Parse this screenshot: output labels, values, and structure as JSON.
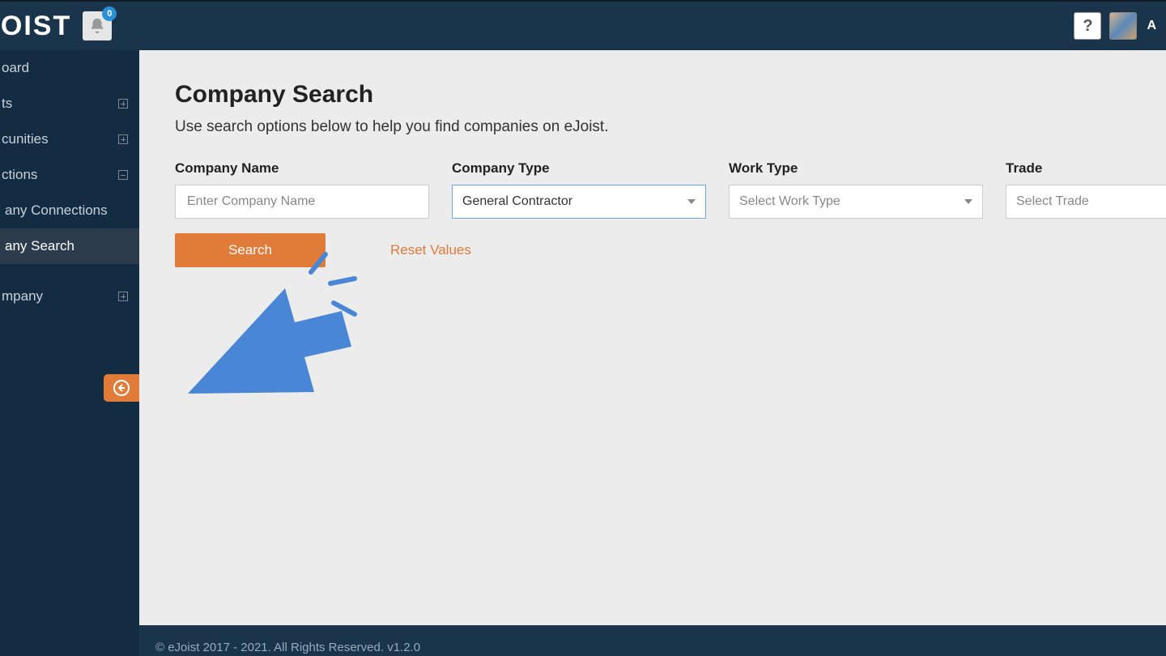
{
  "header": {
    "logo_text": "JOIST",
    "notification_count": "0",
    "user_initial": "A"
  },
  "sidebar": {
    "items": [
      {
        "label": "oard",
        "expandable": false
      },
      {
        "label": "ts",
        "expandable": true,
        "mode": "plus"
      },
      {
        "label": "cunities",
        "expandable": true,
        "mode": "plus"
      },
      {
        "label": "ctions",
        "expandable": true,
        "mode": "minus"
      },
      {
        "label": "any Connections",
        "sub": true
      },
      {
        "label": "any Search",
        "sub": true,
        "active": true
      },
      {
        "label": "mpany",
        "expandable": true,
        "mode": "plus"
      }
    ]
  },
  "page": {
    "title": "Company Search",
    "subtitle": "Use search options below to help you find companies on eJoist."
  },
  "fields": {
    "company_name": {
      "label": "Company Name",
      "placeholder": "Enter Company Name"
    },
    "company_type": {
      "label": "Company Type",
      "value": "General Contractor"
    },
    "work_type": {
      "label": "Work Type",
      "placeholder": "Select Work Type"
    },
    "trade": {
      "label": "Trade",
      "placeholder": "Select Trade"
    }
  },
  "actions": {
    "search": "Search",
    "reset": "Reset Values"
  },
  "footer": {
    "copyright": "© eJoist 2017 - 2021. All Rights Reserved. v1.2.0"
  }
}
